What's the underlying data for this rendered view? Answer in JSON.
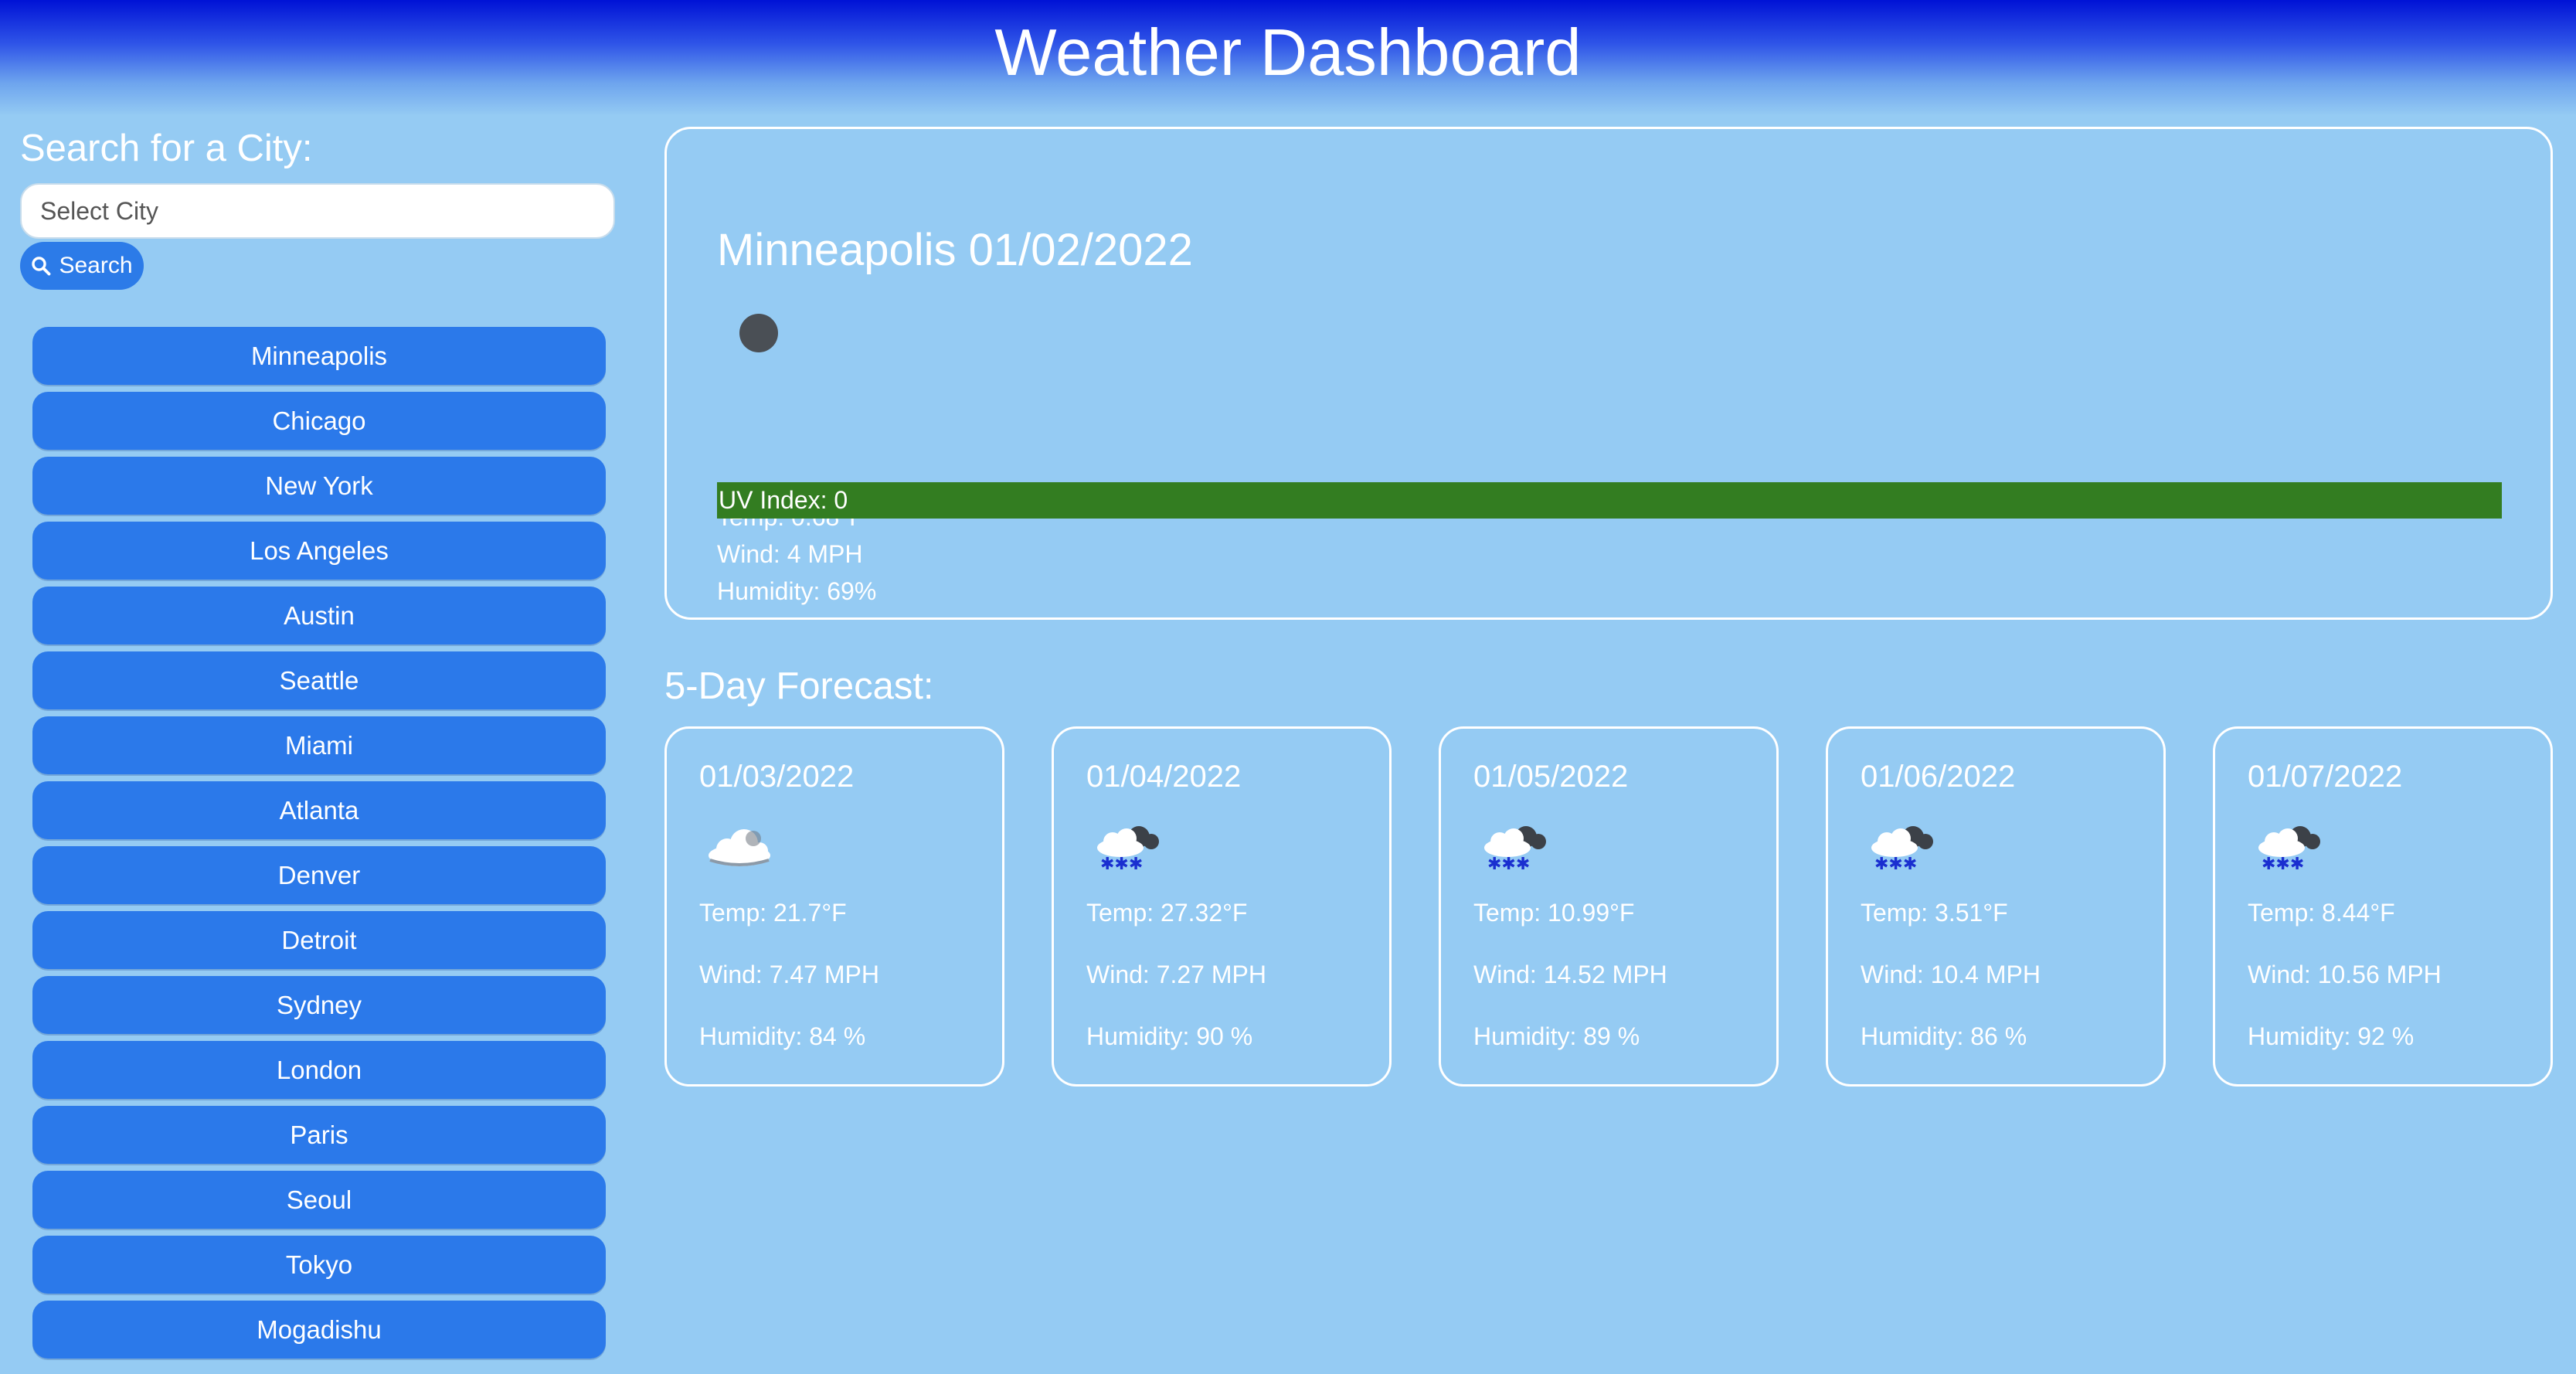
{
  "header": {
    "title": "Weather Dashboard"
  },
  "search": {
    "label": "Search for a City:",
    "placeholder": "Select City",
    "button_label": "Search"
  },
  "cities": [
    "Minneapolis",
    "Chicago",
    "New York",
    "Los Angeles",
    "Austin",
    "Seattle",
    "Miami",
    "Atlanta",
    "Denver",
    "Detroit",
    "Sydney",
    "London",
    "Paris",
    "Seoul",
    "Tokyo",
    "Mogadishu"
  ],
  "current": {
    "heading": "Minneapolis 01/02/2022",
    "icon": "dark-circle-weather-icon",
    "temp": "Temp: 0.68°F",
    "wind": "Wind: 4 MPH",
    "humidity": "Humidity: 69%",
    "uv": "UV Index: 0",
    "uv_color": "#337d21"
  },
  "forecast": {
    "title": "5-Day Forecast:",
    "days": [
      {
        "date": "01/03/2022",
        "icon": "cloudy-icon",
        "temp": "Temp: 21.7°F",
        "wind": "Wind: 7.47 MPH",
        "humidity": "Humidity: 84 %"
      },
      {
        "date": "01/04/2022",
        "icon": "snow-cloud-icon",
        "temp": "Temp: 27.32°F",
        "wind": "Wind: 7.27 MPH",
        "humidity": "Humidity: 90 %"
      },
      {
        "date": "01/05/2022",
        "icon": "snow-cloud-icon",
        "temp": "Temp: 10.99°F",
        "wind": "Wind: 14.52 MPH",
        "humidity": "Humidity: 89 %"
      },
      {
        "date": "01/06/2022",
        "icon": "snow-cloud-icon",
        "temp": "Temp: 3.51°F",
        "wind": "Wind: 10.4 MPH",
        "humidity": "Humidity: 86 %"
      },
      {
        "date": "01/07/2022",
        "icon": "snow-cloud-icon",
        "temp": "Temp: 8.44°F",
        "wind": "Wind: 10.56 MPH",
        "humidity": "Humidity: 92 %"
      }
    ]
  },
  "colors": {
    "background": "#95cbf3",
    "header_top": "#0012d6",
    "button": "#2b79ea",
    "uv_low": "#337d21"
  }
}
